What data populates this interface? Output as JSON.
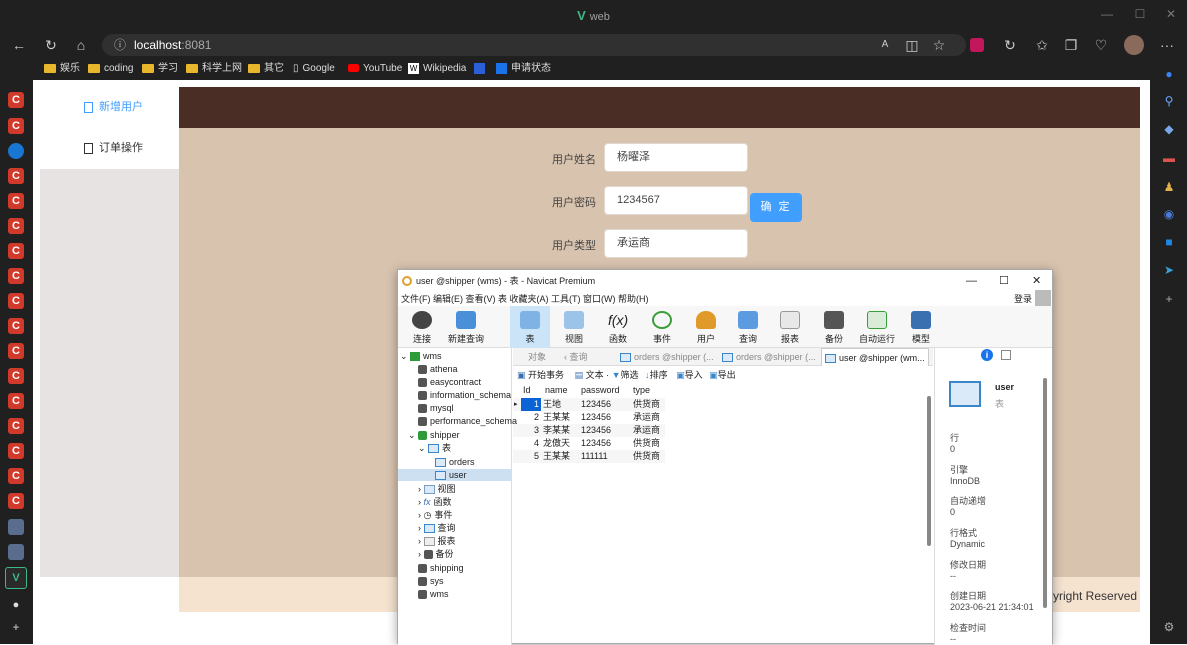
{
  "browser": {
    "window_title": "web",
    "url_host": "localhost",
    "url_port": ":8081",
    "bookmarks": [
      "娱乐",
      "coding",
      "学习",
      "科学上网",
      "其它",
      "Google",
      "YouTube",
      "Wikipedia",
      "申请状态"
    ]
  },
  "app": {
    "menu": [
      "新增用户",
      "订单操作"
    ],
    "form": {
      "name_label": "用户姓名",
      "name_value": "杨曜泽",
      "password_label": "用户密码",
      "password_value": "1234567",
      "type_label": "用户类型",
      "type_value": "承运商",
      "confirm_label": "确 定"
    },
    "footer_text": "yright Reserved"
  },
  "navicat": {
    "title": "user @shipper (wms) - 表 - Navicat Premium",
    "menu": "文件(F)  编辑(E)  查看(V)  表  收藏夹(A)  工具(T)  窗口(W)  帮助(H)",
    "login": "登录",
    "toolbar": [
      "连接",
      "新建查询",
      "表",
      "视图",
      "函数",
      "事件",
      "用户",
      "查询",
      "报表",
      "备份",
      "自动运行",
      "模型"
    ],
    "tree": {
      "root": "wms",
      "dbs": [
        "athena",
        "easycontract",
        "information_schema",
        "mysql",
        "performance_schema"
      ],
      "shipper": "shipper",
      "tables_folder": "表",
      "tables": [
        "orders",
        "user"
      ],
      "folders": [
        "视图",
        "函数",
        "事件",
        "查询",
        "报表",
        "备份"
      ],
      "after": [
        "shipping",
        "sys",
        "wms"
      ]
    },
    "tabs": [
      "对象",
      "查询",
      "orders @shipper (...",
      "orders @shipper (...",
      "user @shipper (wm..."
    ],
    "subtoolbar": [
      "开始事务",
      "文本",
      "筛选",
      "排序",
      "导入",
      "导出"
    ],
    "grid": {
      "columns": [
        "Id",
        "name",
        "password",
        "type"
      ],
      "rows": [
        [
          "1",
          "王地",
          "123456",
          "供货商"
        ],
        [
          "2",
          "王某某",
          "123456",
          "承运商"
        ],
        [
          "3",
          "李某某",
          "123456",
          "承运商"
        ],
        [
          "4",
          "龙傲天",
          "123456",
          "供货商"
        ],
        [
          "5",
          "王某某",
          "111111",
          "供货商"
        ]
      ]
    },
    "info": {
      "table_name": "user",
      "table_kind": "表",
      "rows_label": "行",
      "rows_value": "0",
      "engine_label": "引擎",
      "engine_value": "InnoDB",
      "autoinc_label": "自动递增",
      "autoinc_value": "0",
      "rowformat_label": "行格式",
      "rowformat_value": "Dynamic",
      "modified_label": "修改日期",
      "modified_value": "--",
      "created_label": "创建日期",
      "created_value": "2023-06-21 21:34:01",
      "checked_label": "检查时间",
      "checked_value": "--"
    }
  }
}
